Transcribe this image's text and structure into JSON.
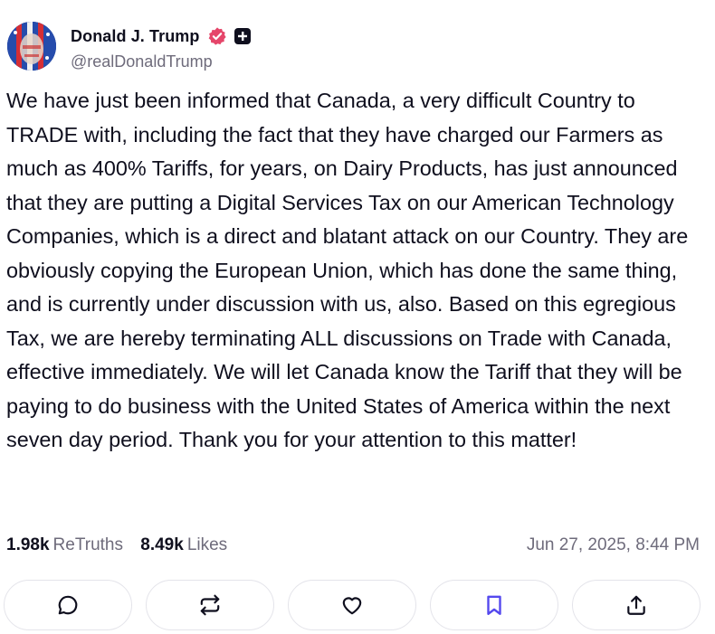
{
  "author": {
    "display_name": "Donald J. Trump",
    "handle": "@realDonaldTrump"
  },
  "post": {
    "text": "We have just been informed that Canada, a very difficult Country to TRADE with, including the fact that they have charged our Farmers as much as 400% Tariffs, for years, on Dairy Products, has just announced that they are putting a Digital Services Tax on our American Technology Companies, which is a direct and blatant attack on our Country. They are obviously copying the European Union, which has done the same thing, and is currently under discussion with us, also. Based on this egregious Tax, we are hereby terminating ALL discussions on Trade with Canada, effective immediately. We will let Canada know the Tariff that they will be paying to do business with the United States of America within the next seven day period. Thank you for your attention to this matter!"
  },
  "stats": {
    "retruths_count": "1.98k",
    "retruths_label": "ReTruths",
    "likes_count": "8.49k",
    "likes_label": "Likes",
    "timestamp": "Jun 27, 2025, 8:44 PM"
  },
  "actions": [
    {
      "icon": "comment-icon"
    },
    {
      "icon": "retruth-icon"
    },
    {
      "icon": "heart-icon"
    },
    {
      "icon": "bookmark-icon"
    },
    {
      "icon": "share-icon"
    }
  ],
  "colors": {
    "text": "#0f0f1e",
    "muted": "#6e6b7b",
    "verified": "#e5466a",
    "accent": "#5448ee",
    "border": "#e4e4ea"
  }
}
